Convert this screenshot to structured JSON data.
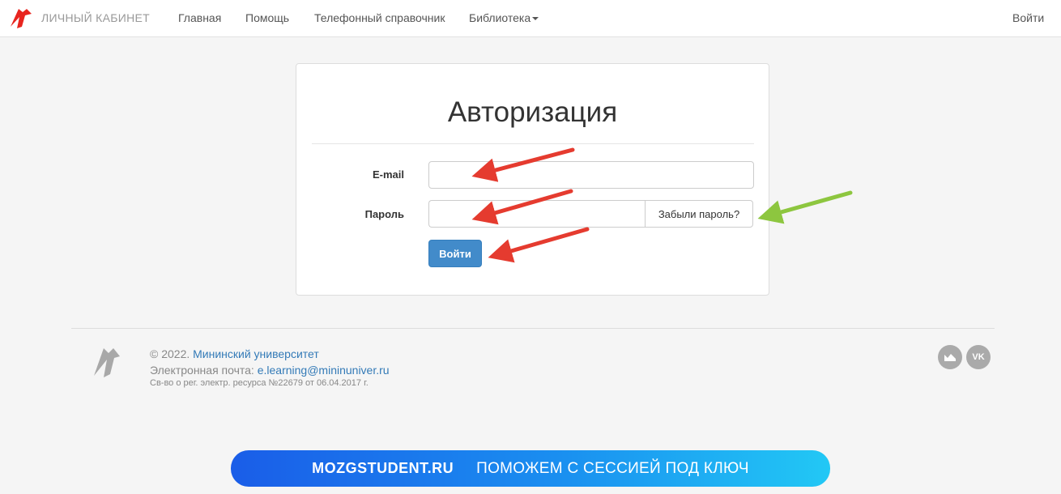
{
  "navbar": {
    "brand": "ЛИЧНЫЙ КАБИНЕТ",
    "items": [
      "Главная",
      "Помощь",
      "Телефонный справочник",
      "Библиотека"
    ],
    "login": "Войти"
  },
  "form": {
    "title": "Авторизация",
    "email_label": "E-mail",
    "email_value": "",
    "password_label": "Пароль",
    "password_value": "",
    "forgot_label": "Забыли пароль?",
    "submit_label": "Войти"
  },
  "footer": {
    "copyright": "© 2022.",
    "university": "Мининский университет",
    "email_label": "Электронная почта:",
    "email": "e.learning@mininuniver.ru",
    "registration": "Св-во о рег. электр. ресурса №22679 от 06.04.2017 г.",
    "social_icons": [
      "gallery-icon",
      "vk-icon"
    ],
    "vk_text": "VK"
  },
  "banner": {
    "site": "MOZGSTUDENT.RU",
    "text": "ПОМОЖЕМ С СЕССИЕЙ ПОД КЛЮЧ"
  },
  "colors": {
    "primary": "#428bca",
    "annotation_red": "#e53b2f",
    "annotation_green": "#8dc63f",
    "brand_red": "#e8251f"
  }
}
